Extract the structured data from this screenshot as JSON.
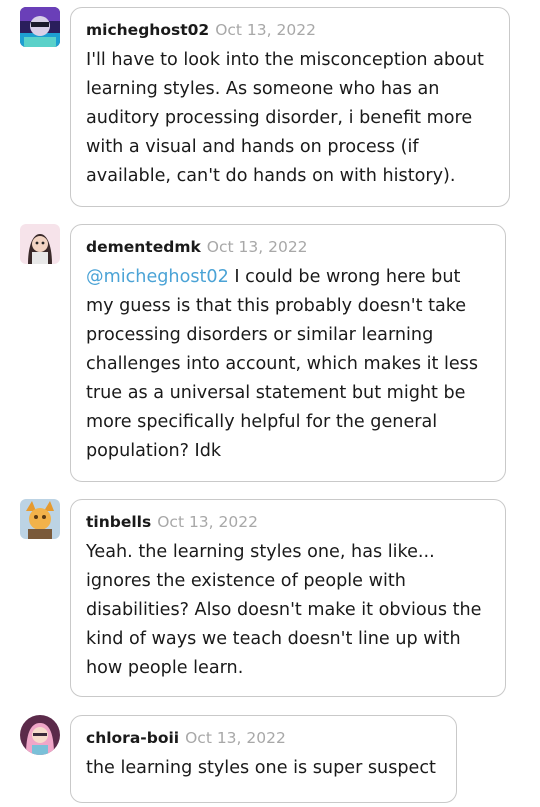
{
  "replies": [
    {
      "username": "micheghost02",
      "date": "Oct 13, 2022",
      "avatar_icon": "avatar-micheghost02",
      "lines": [
        "I'll have to look into the misconception about",
        "learning styles. As someone who has an",
        "auditory processing disorder, i benefit more",
        "with a visual and hands on process (if",
        "available, can't do hands on with history)."
      ]
    },
    {
      "username": "dementedmk",
      "date": "Oct 13, 2022",
      "avatar_icon": "avatar-dementedmk",
      "mention": "@micheghost02",
      "first_line_rest": " I could be wrong here but",
      "lines": [
        "my guess is that this probably doesn't take",
        "processing disorders or similar learning",
        "challenges into account, which makes it less",
        "true as a universal statement but might be",
        "more specifically helpful for the general",
        "population? Idk"
      ]
    },
    {
      "username": "tinbells",
      "date": "Oct 13, 2022",
      "avatar_icon": "avatar-tinbells",
      "lines": [
        "Yeah. the learning styles one, has like...",
        "ignores the existence of people with",
        "disabilities? Also doesn't make it obvious the",
        "kind of ways we teach doesn't line up with",
        "how people learn."
      ]
    },
    {
      "username": "chlora-boii",
      "date": "Oct 13, 2022",
      "avatar_icon": "avatar-chlora-boii",
      "lines": [
        "the learning styles one is super suspect"
      ]
    }
  ],
  "colors": {
    "mention": "#4ba3d6",
    "date": "#a8a8a8",
    "border": "#c9c9c9"
  }
}
